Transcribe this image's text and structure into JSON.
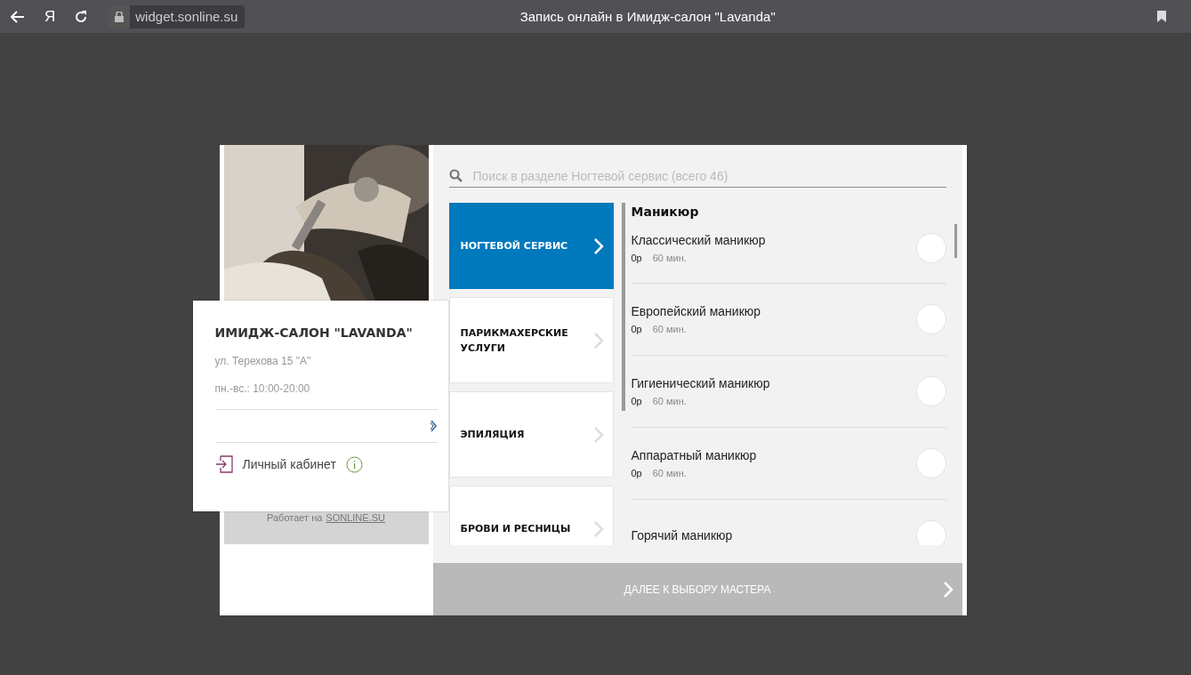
{
  "browser": {
    "address": "widget.sonline.su",
    "title": "Запись онлайн в Имидж-салон \"Lavanda\"",
    "logo": "Я"
  },
  "sidebar": {
    "powered_by": {
      "text": "Работает на",
      "link": "SONLINE.SU"
    }
  },
  "salon_card": {
    "name": "ИМИДЖ-САЛОН \"LAVANDA\"",
    "address": "ул. Терехова 15 \"А\"",
    "hours": "пн.-вс.: 10:00-20:00",
    "account": "Личный кабинет"
  },
  "search": {
    "placeholder": "Поиск в разделе Ногтевой сервис (всего 46)"
  },
  "categories": [
    {
      "label": "НОГТЕВОЙ СЕРВИС",
      "selected": true
    },
    {
      "label": "ПАРИКМАХЕРСКИЕ УСЛУГИ",
      "selected": false
    },
    {
      "label": "ЭПИЛЯЦИЯ",
      "selected": false
    },
    {
      "label": "БРОВИ И РЕСНИЦЫ",
      "selected": false
    }
  ],
  "services": {
    "group": "Маникюр",
    "items": [
      {
        "name": "Классический маникюр",
        "price": "0р",
        "duration": "60 мин.",
        "selected": false
      },
      {
        "name": "Европейский маникюр",
        "price": "0р",
        "duration": "60 мин.",
        "selected": false
      },
      {
        "name": "Гигиенический маникюр",
        "price": "0р",
        "duration": "60 мин.",
        "selected": false
      },
      {
        "name": "Аппаратный маникюр",
        "price": "0р",
        "duration": "60 мин.",
        "selected": false
      },
      {
        "name": "Горячий маникюр",
        "selected": false
      }
    ]
  },
  "next_button": {
    "label": "ДАЛЕЕ К ВЫБОРУ МАСТЕРА",
    "disabled": true
  }
}
